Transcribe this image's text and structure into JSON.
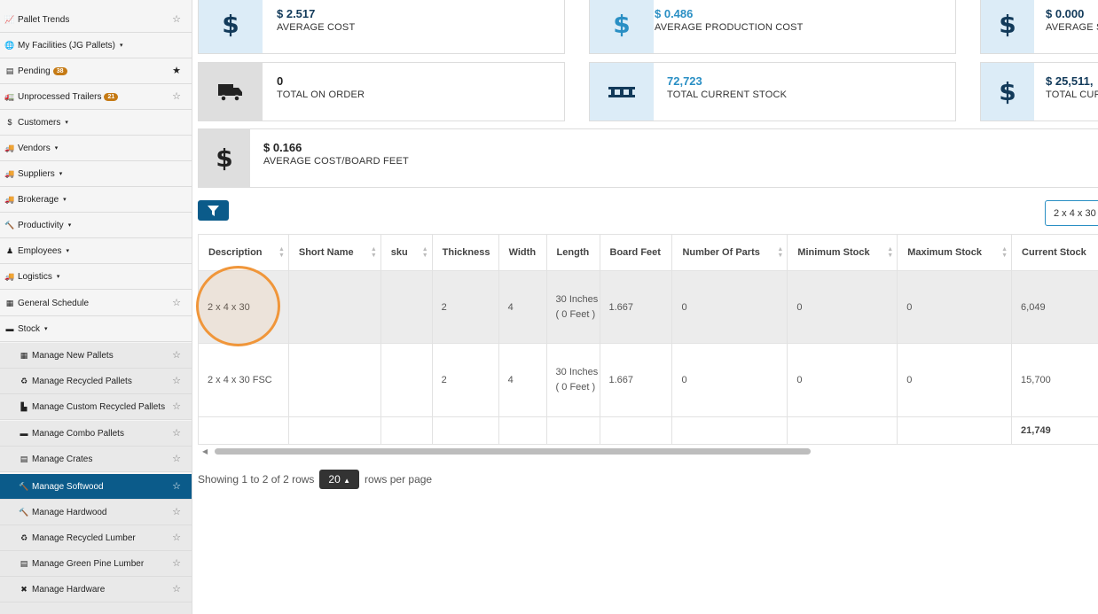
{
  "sidebar": {
    "items": [
      {
        "label": "Pallet Trends",
        "icon": "chart-icon",
        "star": "☆"
      },
      {
        "label": "My Facilities (JG Pallets)",
        "icon": "globe-icon",
        "caret": "▾"
      },
      {
        "label": "Pending",
        "icon": "pending-icon",
        "badge": "38",
        "star": "★"
      },
      {
        "label": "Unprocessed Trailers",
        "icon": "trailer-icon",
        "badge": "21",
        "star": "☆"
      },
      {
        "label": "Customers",
        "icon": "dollar-icon",
        "caret": "▾"
      },
      {
        "label": "Vendors",
        "icon": "truck-icon",
        "caret": "▾"
      },
      {
        "label": "Suppliers",
        "icon": "truck-icon",
        "caret": "▾"
      },
      {
        "label": "Brokerage",
        "icon": "truck-icon",
        "caret": "▾"
      },
      {
        "label": "Productivity",
        "icon": "hammer-icon",
        "caret": "▾"
      },
      {
        "label": "Employees",
        "icon": "person-icon",
        "caret": "▾"
      },
      {
        "label": "Logistics",
        "icon": "truck-icon",
        "caret": "▾"
      },
      {
        "label": "General Schedule",
        "icon": "calendar-icon",
        "star": "☆"
      },
      {
        "label": "Stock",
        "icon": "pallet-icon",
        "caret": "▾"
      }
    ],
    "sub_items": [
      {
        "label": "Manage New Pallets",
        "icon": "pallet-icon",
        "star": "☆"
      },
      {
        "label": "Manage Recycled Pallets",
        "icon": "recycle-icon",
        "star": "☆"
      },
      {
        "label": "Manage Custom Recycled Pallets",
        "icon": "custom-pallet-icon",
        "star": "☆"
      },
      {
        "label": "Manage Combo Pallets",
        "icon": "pallet-icon",
        "star": "☆"
      },
      {
        "label": "Manage Crates",
        "icon": "crate-icon",
        "star": "☆"
      },
      {
        "label": "Manage Softwood",
        "icon": "hammer-icon",
        "star": "☆",
        "active": true
      },
      {
        "label": "Manage Hardwood",
        "icon": "hammer-icon",
        "star": "☆"
      },
      {
        "label": "Manage Recycled Lumber",
        "icon": "recycle-icon",
        "star": "☆"
      },
      {
        "label": "Manage Green Pine Lumber",
        "icon": "crate-icon",
        "star": "☆"
      },
      {
        "label": "Manage Hardware",
        "icon": "tools-icon",
        "star": "☆"
      }
    ]
  },
  "cards": [
    {
      "value": "$ 2.517",
      "label": "AVERAGE COST",
      "icon": "dollar-icon"
    },
    {
      "value": "$ 0.486",
      "label": "AVERAGE PRODUCTION COST",
      "icon": "dollar-icon"
    },
    {
      "value": "$ 0.000",
      "label": "AVERAGE S",
      "icon": "dollar-icon"
    },
    {
      "value": "0",
      "label": "TOTAL ON ORDER",
      "icon": "truck-icon"
    },
    {
      "value": "72,723",
      "label": "TOTAL CURRENT STOCK",
      "icon": "pallet-icon"
    },
    {
      "value": "$ 25,511,",
      "label": "TOTAL CUR",
      "icon": "dollar-icon"
    },
    {
      "value": "$ 0.166",
      "label": "AVERAGE COST/BOARD FEET",
      "icon": "dollar-icon"
    }
  ],
  "search": {
    "value": "2 x 4 x 30"
  },
  "table": {
    "headers": [
      "Description",
      "Short Name",
      "sku",
      "Thickness",
      "Width",
      "Length",
      "Board Feet",
      "Number Of Parts",
      "Minimum Stock",
      "Maximum Stock",
      "Current Stock"
    ],
    "rows": [
      [
        "2 x 4 x 30",
        "",
        "",
        "2",
        "4",
        "30 Inches ( 0 Feet )",
        "1.667",
        "0",
        "0",
        "0",
        "6,049"
      ],
      [
        "2 x 4 x 30 FSC",
        "",
        "",
        "2",
        "4",
        "30 Inches ( 0 Feet )",
        "1.667",
        "0",
        "0",
        "0",
        "15,700"
      ]
    ],
    "footer_total": "21,749"
  },
  "pagination": {
    "showing": "Showing 1 to 2 of 2 rows",
    "per_page": "20",
    "suffix": "rows per page"
  }
}
